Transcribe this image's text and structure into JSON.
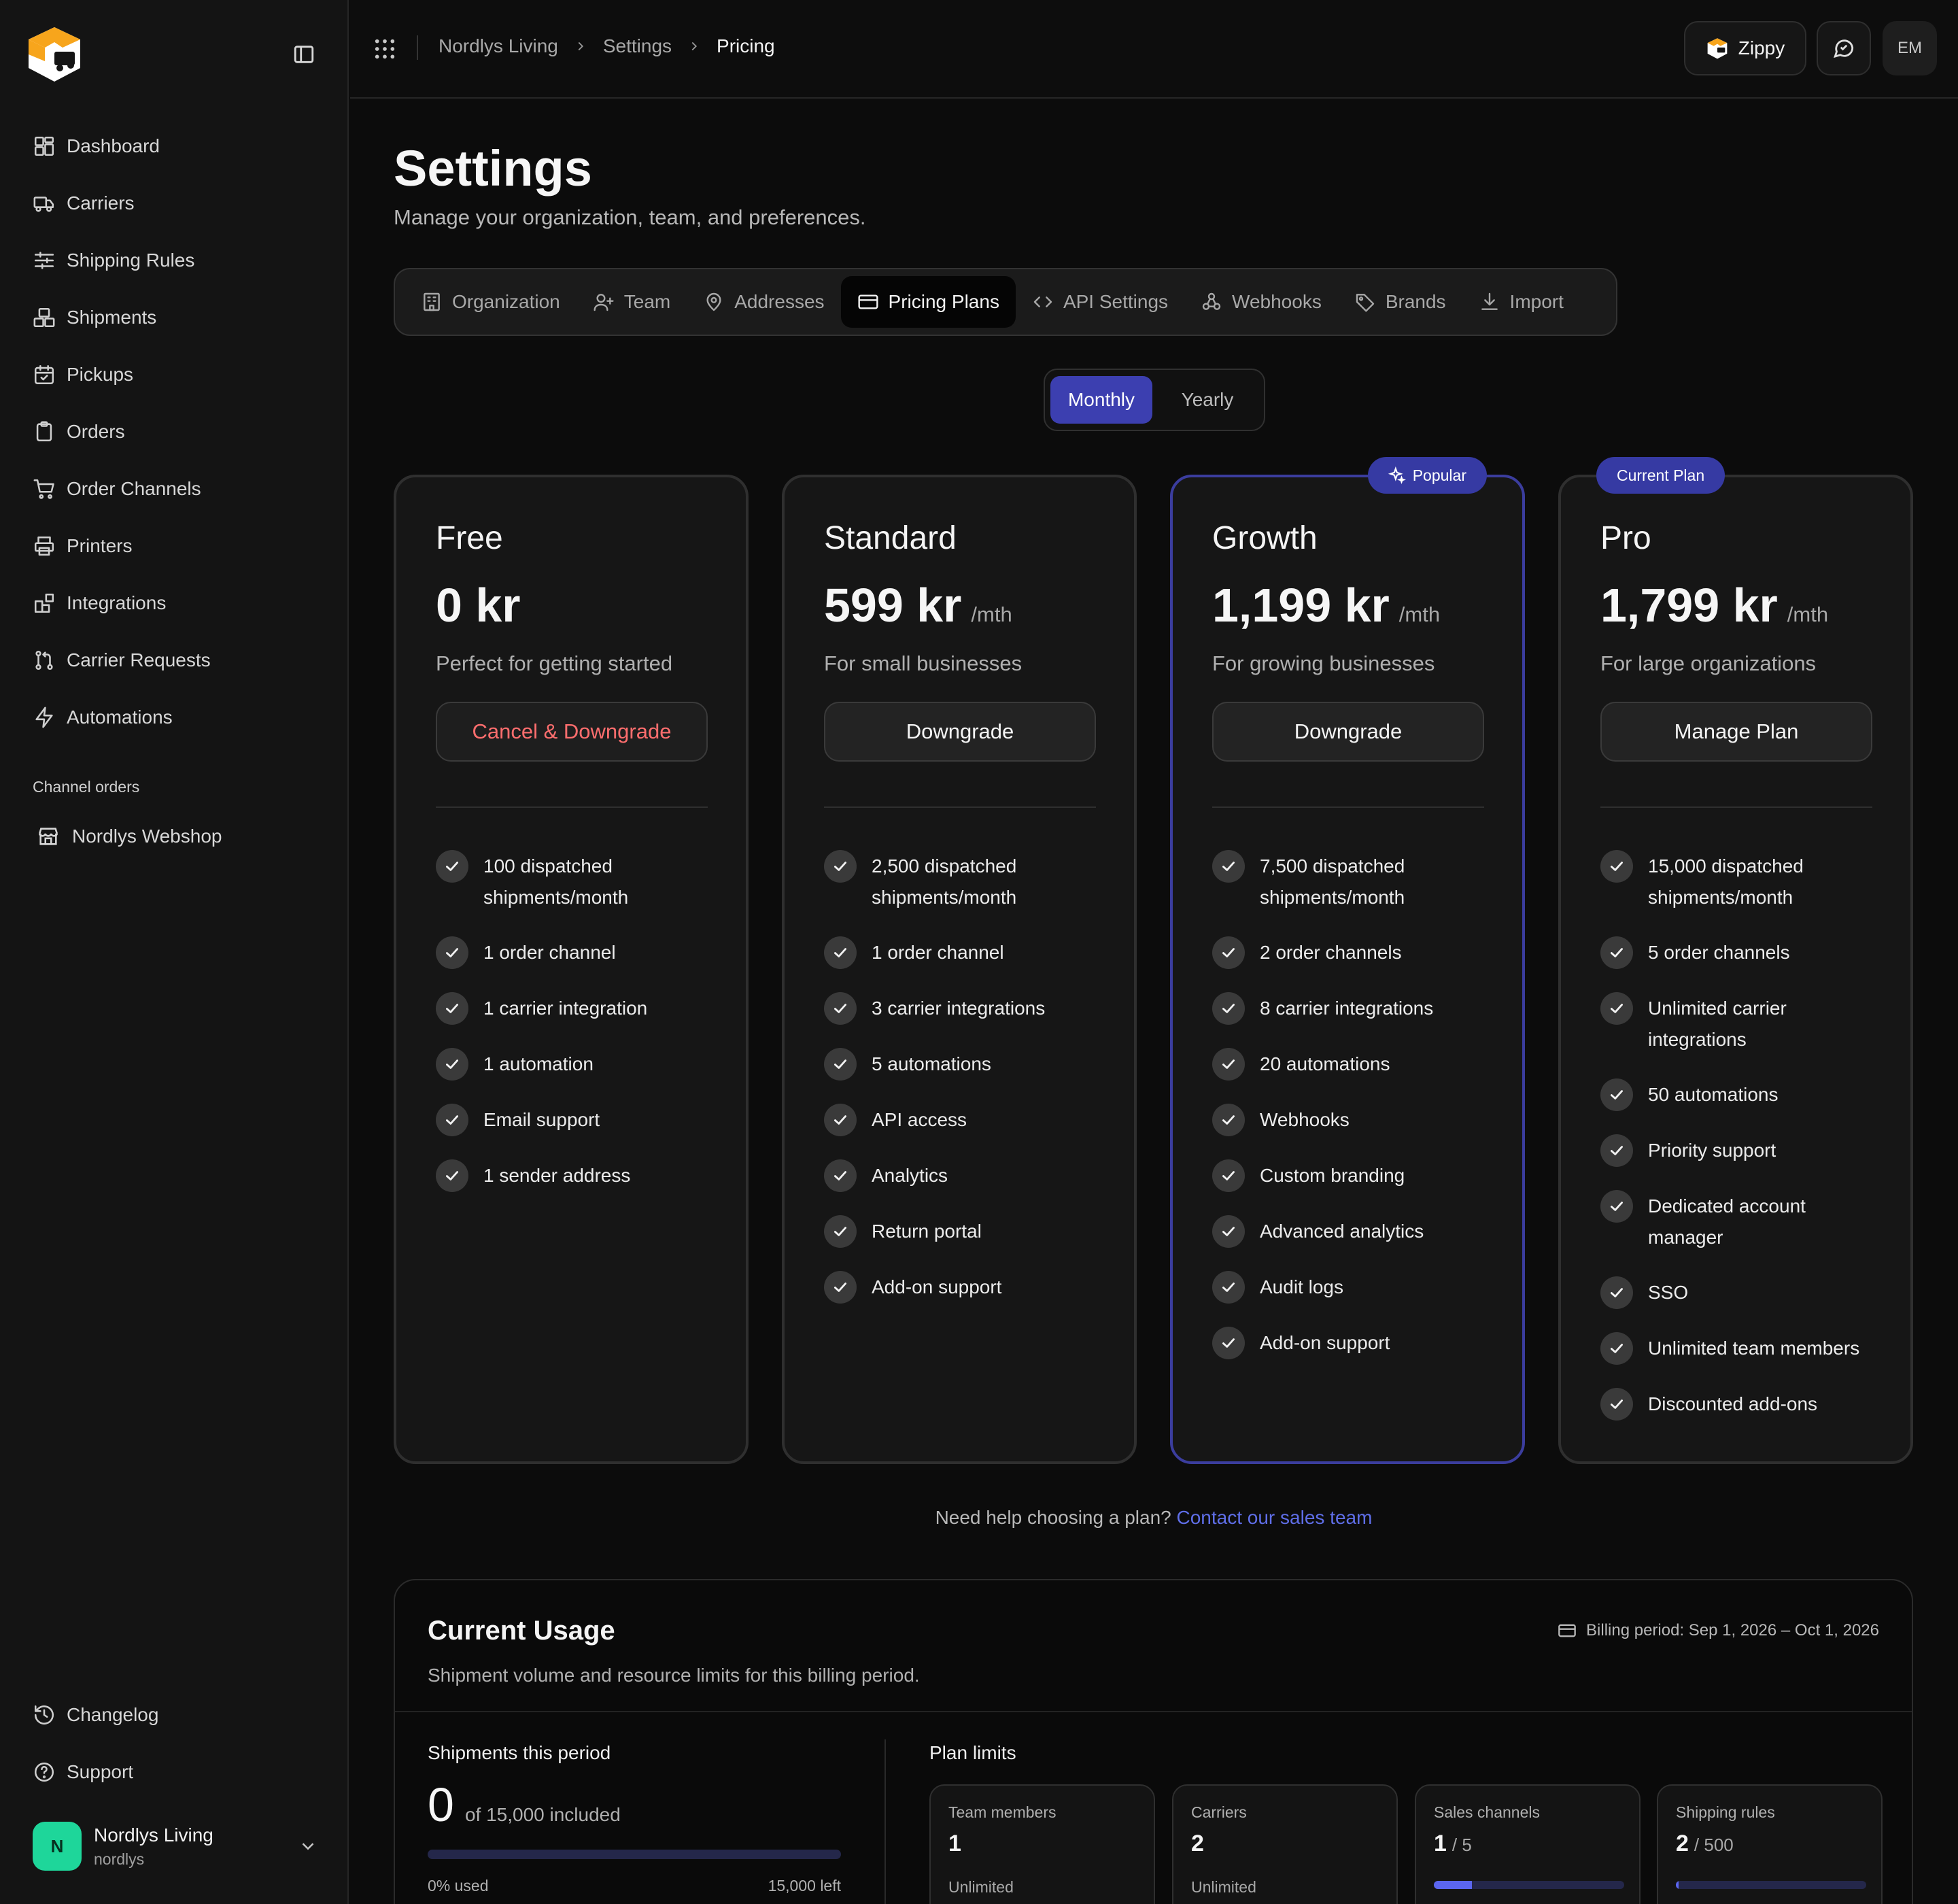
{
  "colors": {
    "accent": "#3c3fb0",
    "danger": "#ff6e6e",
    "link": "#5f6ee8",
    "avatar": "#1ed69a"
  },
  "sidebar": {
    "nav": [
      {
        "label": "Dashboard",
        "icon": "dashboard-icon"
      },
      {
        "label": "Carriers",
        "icon": "truck-icon"
      },
      {
        "label": "Shipping Rules",
        "icon": "sliders-icon"
      },
      {
        "label": "Shipments",
        "icon": "boxes-icon"
      },
      {
        "label": "Pickups",
        "icon": "calendar-check-icon"
      },
      {
        "label": "Orders",
        "icon": "clipboard-icon"
      },
      {
        "label": "Order Channels",
        "icon": "cart-icon"
      },
      {
        "label": "Printers",
        "icon": "printer-icon"
      },
      {
        "label": "Integrations",
        "icon": "blocks-icon"
      },
      {
        "label": "Carrier Requests",
        "icon": "git-pull-icon"
      },
      {
        "label": "Automations",
        "icon": "zap-icon"
      }
    ],
    "channel_section": "Channel orders",
    "channel": "Nordlys Webshop",
    "bottom": [
      {
        "label": "Changelog",
        "icon": "history-icon"
      },
      {
        "label": "Support",
        "icon": "help-circle-icon"
      }
    ],
    "org": {
      "initial": "N",
      "name": "Nordlys Living",
      "slug": "nordlys"
    }
  },
  "topbar": {
    "breadcrumb": [
      "Nordlys Living",
      "Settings",
      "Pricing"
    ],
    "zippy_label": "Zippy",
    "user_initials": "EM"
  },
  "page": {
    "title": "Settings",
    "subtitle": "Manage your organization, team, and preferences."
  },
  "tabs": [
    {
      "label": "Organization",
      "icon": "building-icon",
      "active": false
    },
    {
      "label": "Team",
      "icon": "user-plus-icon",
      "active": false
    },
    {
      "label": "Addresses",
      "icon": "map-pin-icon",
      "active": false
    },
    {
      "label": "Pricing Plans",
      "icon": "credit-card-icon",
      "active": true
    },
    {
      "label": "API Settings",
      "icon": "code-icon",
      "active": false
    },
    {
      "label": "Webhooks",
      "icon": "webhook-icon",
      "active": false
    },
    {
      "label": "Brands",
      "icon": "tag-icon",
      "active": false
    },
    {
      "label": "Import",
      "icon": "download-icon",
      "active": false
    }
  ],
  "billing": {
    "monthly": "Monthly",
    "yearly": "Yearly"
  },
  "plans": [
    {
      "name": "Free",
      "price": "0 kr",
      "per": "",
      "desc": "Perfect for getting started",
      "button": "Cancel & Downgrade",
      "badge": "",
      "features": [
        "100 dispatched shipments/month",
        "1 order channel",
        "1 carrier integration",
        "1 automation",
        "Email support",
        "1 sender address"
      ]
    },
    {
      "name": "Standard",
      "price": "599 kr",
      "per": "/mth",
      "desc": "For small businesses",
      "button": "Downgrade",
      "badge": "",
      "features": [
        "2,500 dispatched shipments/month",
        "1 order channel",
        "3 carrier integrations",
        "5 automations",
        "API access",
        "Analytics",
        "Return portal",
        "Add-on support"
      ]
    },
    {
      "name": "Growth",
      "price": "1,199 kr",
      "per": "/mth",
      "desc": "For growing businesses",
      "button": "Downgrade",
      "badge": "Popular",
      "features": [
        "7,500 dispatched shipments/month",
        "2 order channels",
        "8 carrier integrations",
        "20 automations",
        "Webhooks",
        "Custom branding",
        "Advanced analytics",
        "Audit logs",
        "Add-on support"
      ]
    },
    {
      "name": "Pro",
      "price": "1,799 kr",
      "per": "/mth",
      "desc": "For large organizations",
      "button": "Manage Plan",
      "badge": "Current Plan",
      "features": [
        "15,000 dispatched shipments/month",
        "5 order channels",
        "Unlimited carrier integrations",
        "50 automations",
        "Priority support",
        "Dedicated account manager",
        "SSO",
        "Unlimited team members",
        "Discounted add-ons"
      ]
    }
  ],
  "help": {
    "text": "Need help choosing a plan?",
    "link": "Contact our sales team"
  },
  "usage": {
    "title": "Current Usage",
    "subtitle": "Shipment volume and resource limits for this billing period.",
    "billing_period": "Billing period: Sep 1, 2026 – Oct 1, 2026",
    "shipments_label": "Shipments this period",
    "shipments_count": "0",
    "shipments_of": "of 15,000 included",
    "shipments_fraction": 0,
    "used": "0% used",
    "left": "15,000 left",
    "limits_label": "Plan limits",
    "limits": [
      {
        "name": "Team members",
        "value": "1",
        "max": "",
        "note": "Unlimited",
        "fraction": null
      },
      {
        "name": "Carriers",
        "value": "2",
        "max": "",
        "note": "Unlimited",
        "fraction": null
      },
      {
        "name": "Sales channels",
        "value": "1",
        "max": "/ 5",
        "note": "",
        "fraction": 0.2
      },
      {
        "name": "Shipping rules",
        "value": "2",
        "max": "/ 500",
        "note": "",
        "fraction": 0.004
      }
    ]
  }
}
